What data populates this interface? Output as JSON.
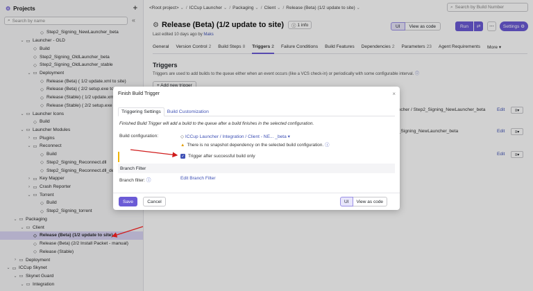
{
  "sidebar": {
    "title": "Projects",
    "search_placeholder": "Search by name",
    "items": [
      {
        "label": "Step2_Signing_NewLauncher_beta",
        "depth": 3,
        "arrow": "",
        "icon": "diamond-icon"
      },
      {
        "label": "Launcher - OLD",
        "depth": 1,
        "arrow": "v",
        "icon": "folder-icon"
      },
      {
        "label": "Build",
        "depth": 2,
        "arrow": "",
        "icon": "diamond-icon"
      },
      {
        "label": "Step2_Signing_OldLauncher_beta",
        "depth": 2,
        "arrow": "",
        "icon": "diamond-icon"
      },
      {
        "label": "Step2_Signing_OldLauncher_stable",
        "depth": 2,
        "arrow": "",
        "icon": "diamond-icon"
      },
      {
        "label": "Deployment",
        "depth": 2,
        "arrow": "v",
        "icon": "folder-icon"
      },
      {
        "label": "Release (Beta) ( 1/2 update.xml to site)",
        "depth": 3,
        "arrow": "",
        "icon": "diamond-icon"
      },
      {
        "label": "Release (Beta) ( 2/2 setup.exe to site)",
        "depth": 3,
        "arrow": "",
        "icon": "diamond-icon"
      },
      {
        "label": "Release (Stable) ( 1/2 update.xml to",
        "depth": 3,
        "arrow": "",
        "icon": "diamond-icon"
      },
      {
        "label": "Release (Stable) ( 2/2 setup.exe to",
        "depth": 3,
        "arrow": "",
        "icon": "diamond-icon"
      },
      {
        "label": "Launcher Icons",
        "depth": 1,
        "arrow": "v",
        "icon": "folder-icon"
      },
      {
        "label": "Build",
        "depth": 2,
        "arrow": "",
        "icon": "diamond-icon"
      },
      {
        "label": "Launcher Modules",
        "depth": 1,
        "arrow": "v",
        "icon": "folder-icon"
      },
      {
        "label": "Plugins",
        "depth": 2,
        "arrow": ">",
        "icon": "folder-icon"
      },
      {
        "label": "Reconnect",
        "depth": 2,
        "arrow": "v",
        "icon": "folder-icon"
      },
      {
        "label": "Build",
        "depth": 3,
        "arrow": "",
        "icon": "diamond-icon"
      },
      {
        "label": "Step2_Signing_Reconnect.dll",
        "depth": 3,
        "arrow": "",
        "icon": "diamond-icon"
      },
      {
        "label": "Step2_Signing_Reconnect.dll_devel",
        "depth": 3,
        "arrow": "",
        "icon": "diamond-icon"
      },
      {
        "label": "Key Mapper",
        "depth": 2,
        "arrow": ">",
        "icon": "folder-icon"
      },
      {
        "label": "Crash Reporter",
        "depth": 2,
        "arrow": ">",
        "icon": "folder-icon"
      },
      {
        "label": "Torrent",
        "depth": 2,
        "arrow": "v",
        "icon": "folder-icon"
      },
      {
        "label": "Build",
        "depth": 3,
        "arrow": "",
        "icon": "diamond-icon"
      },
      {
        "label": "Step2_Signing_torrent",
        "depth": 3,
        "arrow": "",
        "icon": "diamond-icon"
      },
      {
        "label": "Packaging",
        "depth": 0,
        "arrow": "v",
        "icon": "folder-icon"
      },
      {
        "label": "Client",
        "depth": 1,
        "arrow": "v",
        "icon": "folder-icon"
      },
      {
        "label": "Release (Beta) (1/2 update to site)",
        "depth": 2,
        "arrow": "",
        "icon": "diamond-icon",
        "selected": true
      },
      {
        "label": "Release (Beta) (2/2 Install Packet - manual)",
        "depth": 2,
        "arrow": "",
        "icon": "diamond-icon"
      },
      {
        "label": "Release (Stable)",
        "depth": 2,
        "arrow": "",
        "icon": "diamond-icon"
      },
      {
        "label": "Deployment",
        "depth": 0,
        "arrow": ">",
        "icon": "folder-icon"
      },
      {
        "label": "ICCup Skynet",
        "depth": -1,
        "arrow": "v",
        "icon": "folder-icon"
      },
      {
        "label": "Skynet Guard",
        "depth": 0,
        "arrow": "v",
        "icon": "folder-icon"
      },
      {
        "label": "Integration",
        "depth": 1,
        "arrow": "v",
        "icon": "folder-icon"
      }
    ]
  },
  "header": {
    "breadcrumbs": [
      "<Root project>",
      "ICCup Launcher",
      "Packaging",
      "Client",
      "Release (Beta) (1/2 update to site)"
    ],
    "search_placeholder": "Search by Build Number",
    "title": "Release (Beta) (1/2 update to site)",
    "info_label": "1 info",
    "last_edited_prefix": "Last edited 10 days ago by",
    "last_edited_by": "Maks",
    "ui_label": "UI",
    "code_label": "View as code",
    "run_label": "Run",
    "settings_label": "Settings"
  },
  "tabs": [
    {
      "label": "General",
      "count": ""
    },
    {
      "label": "Version Control",
      "count": "2"
    },
    {
      "label": "Build Steps",
      "count": "8"
    },
    {
      "label": "Triggers",
      "count": "2",
      "active": true
    },
    {
      "label": "Failure Conditions",
      "count": ""
    },
    {
      "label": "Build Features",
      "count": ""
    },
    {
      "label": "Dependencies",
      "count": "2"
    },
    {
      "label": "Parameters",
      "count": "23"
    },
    {
      "label": "Agent Requirements",
      "count": ""
    },
    {
      "label": "More",
      "count": ""
    }
  ],
  "triggers": {
    "title": "Triggers",
    "description": "Triggers are used to add builds to the queue either when an event occurs (like a VCS check-in) or periodically with some configurable interval.",
    "add_label": "+ Add new trigger",
    "rows": [
      {
        "text": "uncher / Step2_Signing_NewLauncher_beta",
        "edit": "Edit"
      },
      {
        "text": "2_Signing_NewLauncher_beta",
        "edit": "Edit"
      },
      {
        "text": "",
        "edit": "Edit"
      }
    ]
  },
  "modal": {
    "title": "Finish Build Trigger",
    "tab_settings": "Triggering Settings",
    "tab_custom": "Build Customization",
    "description": "Finished Build Trigger will add a build to the queue after a build finishes in the selected configuration.",
    "build_config_label": "Build configuration:",
    "build_config_value": "ICCup Launcher / Integration / Client - NE... _beta",
    "warning": "There is no snapshot dependency on the selected build configuration.",
    "checkbox_label": "Trigger after successful build only",
    "checkbox_checked": true,
    "branch_filter_header": "Branch Filter",
    "branch_filter_label": "Branch filter:",
    "branch_filter_link": "Edit Branch Filter",
    "save_label": "Save",
    "cancel_label": "Cancel",
    "ui_label": "UI",
    "code_label": "View as code"
  },
  "colors": {
    "accent": "#6b5bd6",
    "link": "#3f51b5",
    "arrow": "#d01c1c",
    "warning": "#e39e00"
  }
}
